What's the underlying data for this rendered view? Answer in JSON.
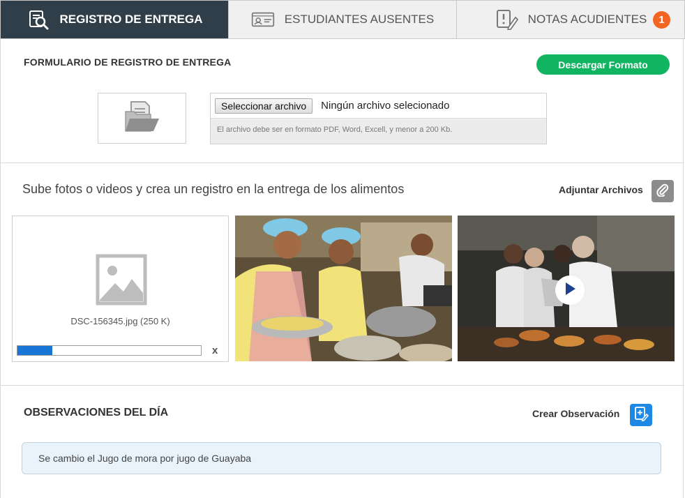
{
  "tabs": [
    {
      "label": "REGISTRO DE ENTREGA",
      "icon": "search-document-icon",
      "active": true
    },
    {
      "label": "ESTUDIANTES AUSENTES",
      "icon": "id-card-icon",
      "active": false
    },
    {
      "label": "NOTAS ACUDIENTES",
      "icon": "note-alert-icon",
      "active": false,
      "badge": "1"
    }
  ],
  "form": {
    "title": "FORMULARIO DE REGISTRO DE ENTREGA",
    "download_label": "Descargar Formato",
    "folder_icon": "folder-document-icon",
    "file_button": "Seleccionar archivo",
    "file_status": "Ningún archivo selecionado",
    "file_hint": "El archivo debe ser en formato PDF, Word, Excell, y menor a 200 Kb."
  },
  "media": {
    "heading": "Sube fotos o videos y crea un registro en la entrega de los alimentos",
    "attach_label": "Adjuntar Archivos",
    "attach_icon": "paperclip-icon",
    "upload": {
      "filename": "DSC-156345.jpg (250 K)",
      "progress": 0.19,
      "remove_label": "x",
      "placeholder_icon": "image-placeholder-icon"
    },
    "photos": [
      {
        "kind": "photo",
        "subject": "kitchen-cooks"
      },
      {
        "kind": "video",
        "subject": "students-food",
        "play_icon": "play-icon"
      }
    ]
  },
  "observations": {
    "title": "OBSERVACIONES DEL DÍA",
    "create_label": "Crear Observación",
    "create_icon": "edit-note-icon",
    "items": [
      "Se cambio el Jugo de mora por jugo de Guayaba"
    ]
  },
  "colors": {
    "active_tab": "#2f3e48",
    "green": "#10b461",
    "badge": "#f26522",
    "progress": "#1877d6",
    "create_button": "#1e88e5",
    "observation_bg": "#e8f3fb"
  }
}
